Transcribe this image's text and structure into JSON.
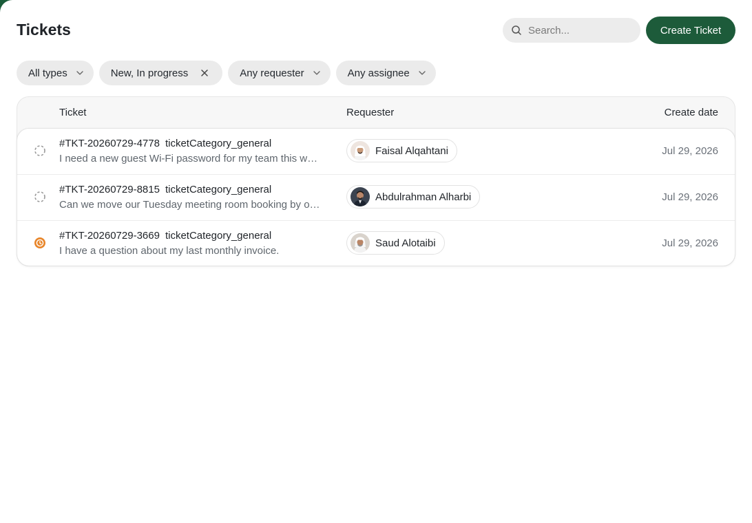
{
  "header": {
    "title": "Tickets",
    "search_placeholder": "Search...",
    "create_label": "Create Ticket"
  },
  "filters": [
    {
      "label": "All types",
      "icon": "chevron-down-icon"
    },
    {
      "label": "New, In progress",
      "icon": "close-icon"
    },
    {
      "label": "Any requester",
      "icon": "chevron-down-icon"
    },
    {
      "label": "Any assignee",
      "icon": "chevron-down-icon"
    }
  ],
  "table": {
    "columns": [
      "Ticket",
      "Requester",
      "Create date"
    ],
    "rows": [
      {
        "status": "new",
        "status_icon": "dashed-circle-icon",
        "id": "#TKT-20260729-4778",
        "category": "ticketCategory_general",
        "description": "I need a new guest Wi-Fi password for my team this week.",
        "requester": "Faisal Alqahtani",
        "date": "Jul 29, 2026"
      },
      {
        "status": "new",
        "status_icon": "dashed-circle-icon",
        "id": "#TKT-20260729-8815",
        "category": "ticketCategory_general",
        "description": "Can we move our Tuesday meeting room booking by one hour?",
        "requester": "Abdulrahman Alharbi",
        "date": "Jul 29, 2026"
      },
      {
        "status": "in-progress",
        "status_icon": "clock-icon",
        "id": "#TKT-20260729-3669",
        "category": "ticketCategory_general",
        "description": "I have a question about my last monthly invoice.",
        "requester": "Saud Alotaibi",
        "date": "Jul 29, 2026"
      }
    ]
  },
  "colors": {
    "brand": "#1d5b3a",
    "in_progress": "#e8862b",
    "chip_bg": "#ebebeb"
  }
}
